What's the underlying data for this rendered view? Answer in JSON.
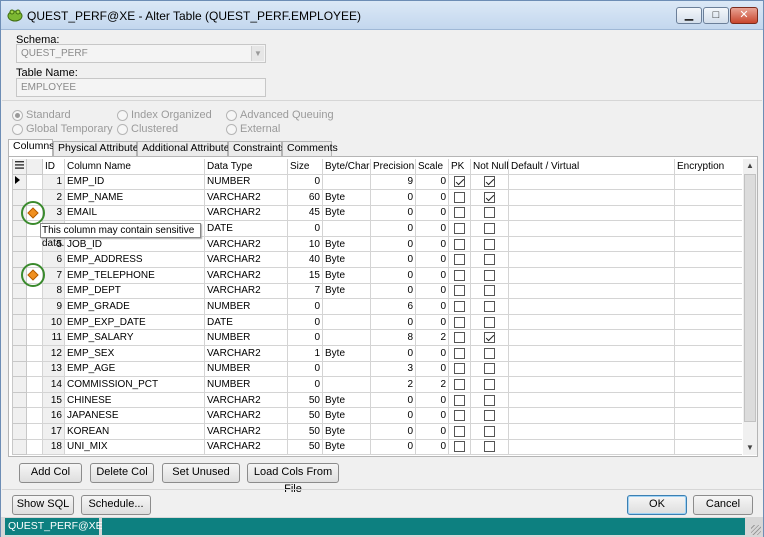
{
  "window": {
    "title": "QUEST_PERF@XE - Alter Table (QUEST_PERF.EMPLOYEE)"
  },
  "form": {
    "schema_label": "Schema:",
    "schema_value": "QUEST_PERF",
    "table_name_label": "Table Name:",
    "table_name_value": "EMPLOYEE"
  },
  "table_type": {
    "options": [
      {
        "label": "Standard",
        "checked": true
      },
      {
        "label": "Index Organized",
        "checked": false
      },
      {
        "label": "Advanced Queuing",
        "checked": false
      },
      {
        "label": "Global Temporary",
        "checked": false
      },
      {
        "label": "Clustered",
        "checked": false
      },
      {
        "label": "External",
        "checked": false
      }
    ]
  },
  "tabs": [
    "Columns",
    "Physical Attributes",
    "Additional Attributes",
    "Constraints",
    "Comments"
  ],
  "grid": {
    "headers": [
      "ID",
      "Column Name",
      "Data Type",
      "Size",
      "Byte/Char",
      "Precision",
      "Scale",
      "PK",
      "Not Null",
      "Default / Virtual",
      "Encryption"
    ],
    "rows": [
      {
        "id": "1",
        "name": "EMP_ID",
        "type": "NUMBER",
        "size": "0",
        "unit": "",
        "precision": "9",
        "scale": "0",
        "pk": true,
        "notnull": true
      },
      {
        "id": "2",
        "name": "EMP_NAME",
        "type": "VARCHAR2",
        "size": "60",
        "unit": "Byte",
        "precision": "0",
        "scale": "0",
        "pk": false,
        "notnull": true
      },
      {
        "id": "3",
        "name": "EMAIL",
        "type": "VARCHAR2",
        "size": "45",
        "unit": "Byte",
        "precision": "0",
        "scale": "0",
        "pk": false,
        "notnull": false
      },
      {
        "id": "4",
        "name": "",
        "type": "DATE",
        "size": "0",
        "unit": "",
        "precision": "0",
        "scale": "0",
        "pk": false,
        "notnull": false
      },
      {
        "id": "5",
        "name": "JOB_ID",
        "type": "VARCHAR2",
        "size": "10",
        "unit": "Byte",
        "precision": "0",
        "scale": "0",
        "pk": false,
        "notnull": false
      },
      {
        "id": "6",
        "name": "EMP_ADDRESS",
        "type": "VARCHAR2",
        "size": "40",
        "unit": "Byte",
        "precision": "0",
        "scale": "0",
        "pk": false,
        "notnull": false
      },
      {
        "id": "7",
        "name": "EMP_TELEPHONE",
        "type": "VARCHAR2",
        "size": "15",
        "unit": "Byte",
        "precision": "0",
        "scale": "0",
        "pk": false,
        "notnull": false
      },
      {
        "id": "8",
        "name": "EMP_DEPT",
        "type": "VARCHAR2",
        "size": "7",
        "unit": "Byte",
        "precision": "0",
        "scale": "0",
        "pk": false,
        "notnull": false
      },
      {
        "id": "9",
        "name": "EMP_GRADE",
        "type": "NUMBER",
        "size": "0",
        "unit": "",
        "precision": "6",
        "scale": "0",
        "pk": false,
        "notnull": false
      },
      {
        "id": "10",
        "name": "EMP_EXP_DATE",
        "type": "DATE",
        "size": "0",
        "unit": "",
        "precision": "0",
        "scale": "0",
        "pk": false,
        "notnull": false
      },
      {
        "id": "11",
        "name": "EMP_SALARY",
        "type": "NUMBER",
        "size": "0",
        "unit": "",
        "precision": "8",
        "scale": "2",
        "pk": false,
        "notnull": true
      },
      {
        "id": "12",
        "name": "EMP_SEX",
        "type": "VARCHAR2",
        "size": "1",
        "unit": "Byte",
        "precision": "0",
        "scale": "0",
        "pk": false,
        "notnull": false
      },
      {
        "id": "13",
        "name": "EMP_AGE",
        "type": "NUMBER",
        "size": "0",
        "unit": "",
        "precision": "3",
        "scale": "0",
        "pk": false,
        "notnull": false
      },
      {
        "id": "14",
        "name": "COMMISSION_PCT",
        "type": "NUMBER",
        "size": "0",
        "unit": "",
        "precision": "2",
        "scale": "2",
        "pk": false,
        "notnull": false
      },
      {
        "id": "15",
        "name": "CHINESE",
        "type": "VARCHAR2",
        "size": "50",
        "unit": "Byte",
        "precision": "0",
        "scale": "0",
        "pk": false,
        "notnull": false
      },
      {
        "id": "16",
        "name": "JAPANESE",
        "type": "VARCHAR2",
        "size": "50",
        "unit": "Byte",
        "precision": "0",
        "scale": "0",
        "pk": false,
        "notnull": false
      },
      {
        "id": "17",
        "name": "KOREAN",
        "type": "VARCHAR2",
        "size": "50",
        "unit": "Byte",
        "precision": "0",
        "scale": "0",
        "pk": false,
        "notnull": false
      },
      {
        "id": "18",
        "name": "UNI_MIX",
        "type": "VARCHAR2",
        "size": "50",
        "unit": "Byte",
        "precision": "0",
        "scale": "0",
        "pk": false,
        "notnull": false
      }
    ],
    "sensitive_rows": [
      3,
      7
    ],
    "tooltip": "This column may contain sensitive data."
  },
  "column_buttons": {
    "add": "Add Col",
    "delete": "Delete Col",
    "set_unused": "Set Unused",
    "load": "Load Cols From File"
  },
  "footer_buttons": {
    "show_sql": "Show SQL",
    "schedule": "Schedule...",
    "ok": "OK",
    "cancel": "Cancel"
  },
  "status": {
    "connection": "QUEST_PERF@XE"
  },
  "colors": {
    "status_bar": "#0d8080",
    "sensitive_ring": "#3a8a2d",
    "sensitive_marker": "#f09020"
  }
}
